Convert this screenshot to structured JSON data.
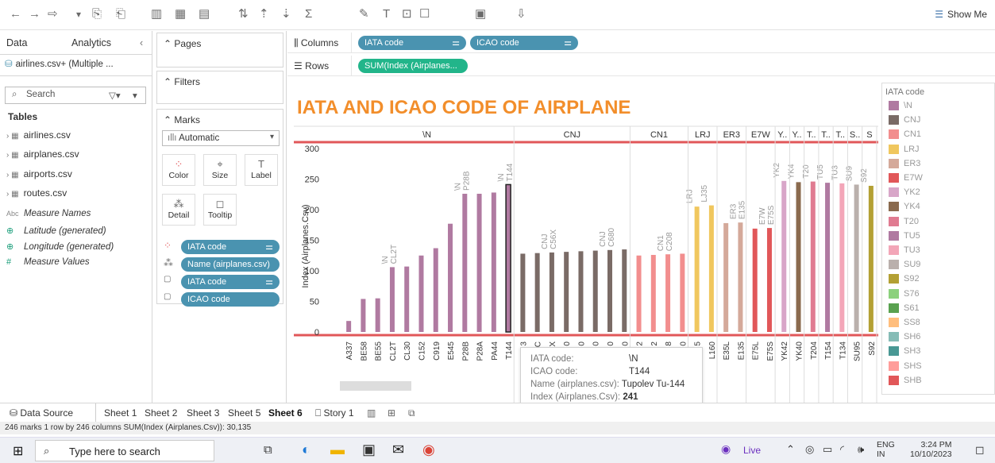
{
  "toolbar": {
    "show_me": "Show Me"
  },
  "left": {
    "tab_data": "Data",
    "tab_analytics": "Analytics",
    "datasource": "airlines.csv+ (Multiple ...",
    "search_placeholder": "Search",
    "tables_header": "Tables",
    "tables": [
      "airlines.csv",
      "airplanes.csv",
      "airports.csv",
      "routes.csv"
    ],
    "measures": [
      {
        "icon": "Abc",
        "label": "Measure Names"
      },
      {
        "icon": "⊕",
        "label": "Latitude (generated)"
      },
      {
        "icon": "⊕",
        "label": "Longitude (generated)"
      },
      {
        "icon": "#",
        "label": "Measure Values"
      }
    ]
  },
  "mid": {
    "pages": "Pages",
    "filters": "Filters",
    "marks": "Marks",
    "mark_type": "Automatic",
    "btn_color": "Color",
    "btn_size": "Size",
    "btn_label": "Label",
    "btn_detail": "Detail",
    "btn_tooltip": "Tooltip",
    "mark_pills": [
      "IATA code",
      "Name (airplanes.csv)",
      "IATA code",
      "ICAO code"
    ]
  },
  "shelves": {
    "columns_label": "Columns",
    "rows_label": "Rows",
    "col_pill_1": "IATA code",
    "col_pill_2": "ICAO code",
    "row_pill": "SUM(Index (Airplanes..."
  },
  "chart_data": {
    "type": "bar",
    "title": "IATA AND ICAO CODE OF AIRPLANE",
    "ylabel": "Index (Airplanes.Csv)",
    "ylim": [
      0,
      310
    ],
    "yticks": [
      0,
      50,
      100,
      150,
      200,
      250,
      300
    ],
    "groups": [
      "\\N",
      "CNJ",
      "CN1",
      "LRJ",
      "ER3",
      "E7W",
      "Y..",
      "Y..",
      "T..",
      "T..",
      "T..",
      "S..",
      "S"
    ],
    "categories": [
      "A337",
      "BE58",
      "BE55",
      "CL2T",
      "CL30",
      "C152",
      "C919",
      "E545",
      "P28B",
      "P28A",
      "PA44",
      "T144",
      "3",
      "C",
      "X",
      "0",
      "0",
      "0",
      "0",
      "0",
      "2",
      "2",
      "8",
      "0",
      "5",
      "L160",
      "E35L",
      "E135",
      "E75L",
      "E75S",
      "YK42",
      "YK40",
      "T204",
      "T154",
      "T134",
      "SU95",
      "S92"
    ],
    "values": [
      18,
      54,
      55,
      106,
      107,
      125,
      137,
      177,
      226,
      226,
      228,
      241,
      128,
      129,
      130,
      131,
      132,
      133,
      134,
      135,
      125,
      126,
      127,
      128,
      205,
      207,
      178,
      179,
      169,
      170,
      247,
      245,
      246,
      244,
      243,
      241,
      239
    ],
    "colors": [
      "#b07aa1",
      "#b07aa1",
      "#b07aa1",
      "#b07aa1",
      "#b07aa1",
      "#b07aa1",
      "#b07aa1",
      "#b07aa1",
      "#b07aa1",
      "#b07aa1",
      "#b07aa1",
      "#b07aa1",
      "#7a6b66",
      "#7a6b66",
      "#7a6b66",
      "#7a6b66",
      "#7a6b66",
      "#7a6b66",
      "#7a6b66",
      "#7a6b66",
      "#f28e8e",
      "#f28e8e",
      "#f28e8e",
      "#f28e8e",
      "#f0c75e",
      "#f0c75e",
      "#d4a99a",
      "#d4a99a",
      "#e15759",
      "#e15759",
      "#d8a6c8",
      "#8a6a4e",
      "#e07b91",
      "#b07aa1",
      "#f3a6b8",
      "#bab0ac",
      "#b3a034"
    ],
    "data_labels": [
      {
        "i": 3,
        "lines": [
          "\\N",
          "CL2T"
        ]
      },
      {
        "i": 8,
        "lines": [
          "\\N",
          "P28B"
        ]
      },
      {
        "i": 11,
        "lines": [
          "\\N",
          "T144"
        ]
      },
      {
        "i": 14,
        "lines": [
          "CNJ",
          "C56X"
        ]
      },
      {
        "i": 18,
        "lines": [
          "CNJ",
          "C680"
        ]
      },
      {
        "i": 22,
        "lines": [
          "CN1",
          "C208"
        ]
      },
      {
        "i": 24,
        "lines": [
          "LRJ"
        ]
      },
      {
        "i": 25,
        "lines": [
          "LJ35"
        ]
      },
      {
        "i": 27,
        "lines": [
          "ER3",
          "E135"
        ]
      },
      {
        "i": 29,
        "lines": [
          "E7W",
          "E75S"
        ]
      },
      {
        "i": 30,
        "lines": [
          "YK2"
        ]
      },
      {
        "i": 31,
        "lines": [
          "YK4"
        ]
      },
      {
        "i": 32,
        "lines": [
          "T20"
        ]
      },
      {
        "i": 33,
        "lines": [
          "TU5"
        ]
      },
      {
        "i": 34,
        "lines": [
          "TU3"
        ]
      },
      {
        "i": 35,
        "lines": [
          "SU9"
        ]
      },
      {
        "i": 36,
        "lines": [
          "S92"
        ]
      }
    ],
    "legend_title": "IATA code",
    "legend": [
      {
        "name": "\\N",
        "color": "#b07aa1"
      },
      {
        "name": "CNJ",
        "color": "#7a6b66"
      },
      {
        "name": "CN1",
        "color": "#f28e8e"
      },
      {
        "name": "LRJ",
        "color": "#f0c75e"
      },
      {
        "name": "ER3",
        "color": "#d4a99a"
      },
      {
        "name": "E7W",
        "color": "#e15759"
      },
      {
        "name": "YK2",
        "color": "#d8a6c8"
      },
      {
        "name": "YK4",
        "color": "#8a6a4e"
      },
      {
        "name": "T20",
        "color": "#e07b91"
      },
      {
        "name": "TU5",
        "color": "#b07aa1"
      },
      {
        "name": "TU3",
        "color": "#f3a6b8"
      },
      {
        "name": "SU9",
        "color": "#bab0ac"
      },
      {
        "name": "S92",
        "color": "#b3a034"
      },
      {
        "name": "S76",
        "color": "#8cd17d"
      },
      {
        "name": "S61",
        "color": "#59a14f"
      },
      {
        "name": "SS8",
        "color": "#ffbe7d"
      },
      {
        "name": "SH6",
        "color": "#86bcb6"
      },
      {
        "name": "SH3",
        "color": "#499894"
      },
      {
        "name": "SHS",
        "color": "#ff9d9a"
      },
      {
        "name": "SHB",
        "color": "#e15759"
      }
    ]
  },
  "tooltip": {
    "k1": "IATA code:",
    "v1": "\\N",
    "k2": "ICAO code:",
    "v2": "T144",
    "k3": "Name (airplanes.csv):",
    "v3": "Tupolev Tu-144",
    "k4": "Index (Airplanes.Csv):",
    "v4": "241"
  },
  "sheets": {
    "datasource": "Data Source",
    "tabs": [
      "Sheet 1",
      "Sheet 2",
      "Sheet 3",
      "Sheet 5",
      "Sheet 6",
      "Story 1"
    ]
  },
  "status": "246 marks   1 row by 246 columns   SUM(Index (Airplanes.Csv)): 30,135",
  "taskbar": {
    "search": "Type here to search",
    "live": "Live",
    "lang1": "ENG",
    "lang2": "IN",
    "time": "3:24 PM",
    "date": "10/10/2023"
  }
}
